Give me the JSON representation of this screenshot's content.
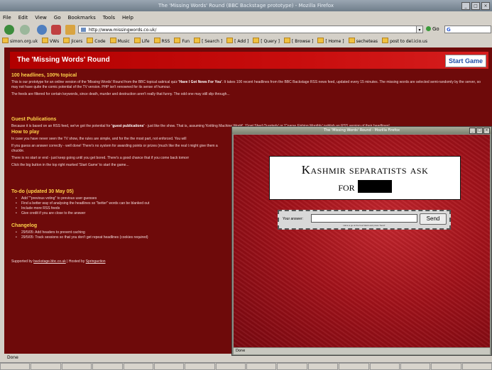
{
  "browser": {
    "title": "The 'Missing Words' Round (BBC Backstage prototype) - Mozilla Firefox",
    "menu": [
      "File",
      "Edit",
      "View",
      "Go",
      "Bookmarks",
      "Tools",
      "Help"
    ],
    "url": "http://www.missingwords.co.uk/",
    "go_label": "Go",
    "search_glyph": "G",
    "bookmarks": [
      "simon.org.uk",
      "VWs",
      "Jicers",
      "Code",
      "Music",
      "Life",
      "RSS",
      "Fun",
      "[ Search ]",
      "[ Add ]",
      "[ Query ]",
      "[ Browse ]",
      "[ Home ]",
      "secheteas",
      "post to del.icio.us"
    ],
    "status": "Done",
    "taskbar": [
      "",
      "",
      "",
      "",
      "",
      "",
      "",
      "",
      "",
      "",
      "",
      "",
      "",
      "",
      "",
      ""
    ]
  },
  "page": {
    "title": "The 'Missing Words' Round",
    "start_button": "Start Game",
    "sections": {
      "intro_heading": "100 headlines, 100% topical",
      "intro_p1_a": "This is our prototype for an online version of the 'Missing Words' Round from the BBC topical satirical quiz ",
      "intro_p1_b": "'Have I Got News For You'",
      "intro_p1_c": ". It takes 100 recent headlines from the BBC Backstage RSS news feed, updated every 15 minutes. The missing words are selected semi-randomly by the server, so may not have quite the comic potential of the TV version. PHP isn't renowned for its sense of humour.",
      "intro_p2": "The feeds are filtered for certain keywords, since death, murder and destruction aren't really that funny. The odd one may still slip through...",
      "guest_heading": "Guest Publications",
      "guest_p_a": "Because it is based on an RSS feed, we've got the potential for ",
      "guest_p_b": "'guest publications'",
      "guest_p_c": " - just like the show. That is, assuming 'Knitting Machine World', 'Goat Shed Quarterly' or 'Coarse Fishing Monthly' publish an RSS version of their headlines!",
      "howto_heading": "How to play",
      "howto_p1": "In case you have never seen the TV show, the rules are simple, and for the the most part, not enforced. You will",
      "howto_p2": "If you guess an answer correctly - well done! There's no system for awarding points or prizes (much like the real t might give them a chuckle.",
      "howto_p3": "There is no start or end - just keep going until you get bored. There's a good chance that if you come back tomorr",
      "howto_p4": "Click the big button in the top right marked 'Start Game' to start the game...",
      "todo_heading": "To-do (updated 30 May 05)",
      "todo_items": [
        "Add \"\"previous voting\" to previous user guesses",
        "Find a better way of analysing the headlines so \"better\" words can be blanked out",
        "Include more RSS feeds",
        "Give credit if you are close to the answer"
      ],
      "changelog_heading": "Changelog",
      "changelog_items": [
        "29/5/05: Add headers to prevent caching",
        "29/5/05: Track sessions so that you don't get repeat headlines (cookies required)"
      ],
      "footer_a": "Supported by ",
      "footer_link1": "backstage.bbc.co.uk",
      "footer_b": " | Hosted by ",
      "footer_link2": "Springaction"
    }
  },
  "game_window": {
    "title": "The 'Missing Words' Round - Mozilla Firefox",
    "headline_line1": "Kashmir separatists ask",
    "headline_line2": "for",
    "answer_label": "Your answer:",
    "answer_value": "",
    "send_label": "Send",
    "hint": "Have a go at the four blank and press 'Send'",
    "status": "Done"
  }
}
